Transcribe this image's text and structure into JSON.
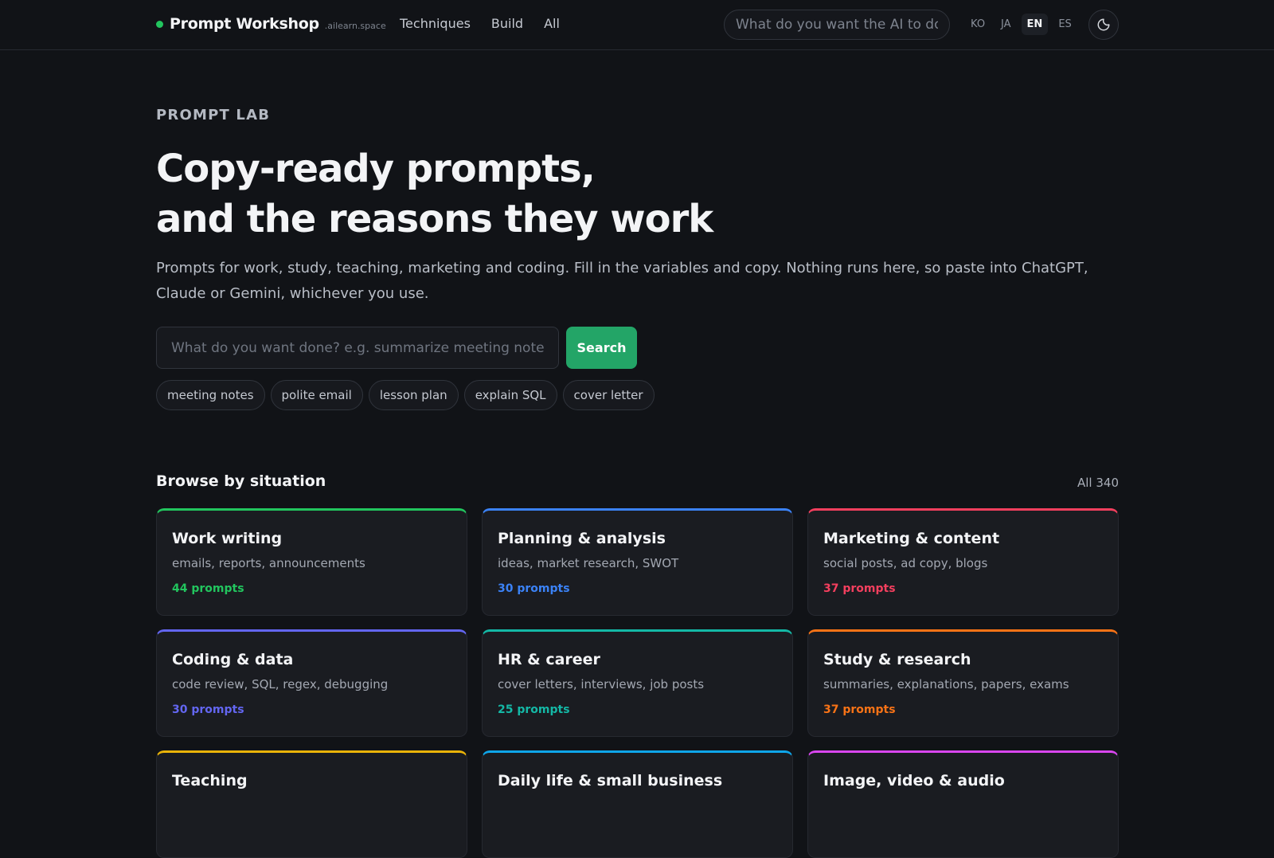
{
  "header": {
    "brand": "Prompt Workshop",
    "domain": ".ailearn.space",
    "nav": [
      "Techniques",
      "Build",
      "All"
    ],
    "search_placeholder": "What do you want the AI to do?",
    "languages": [
      {
        "code": "KO",
        "active": false
      },
      {
        "code": "JA",
        "active": false
      },
      {
        "code": "EN",
        "active": true
      },
      {
        "code": "ES",
        "active": false
      }
    ],
    "theme_icon": "moon-icon"
  },
  "hero": {
    "eyebrow": "PROMPT LAB",
    "headline_line1": "Copy-ready prompts,",
    "headline_line2": "and the reasons they work",
    "lead": "Prompts for work, study, teaching, marketing and coding. Fill in the variables and copy. Nothing runs here, so paste into ChatGPT, Claude or Gemini, whichever you use.",
    "search_placeholder": "What do you want done? e.g. summarize meeting notes",
    "search_button": "Search",
    "chips": [
      "meeting notes",
      "polite email",
      "lesson plan",
      "explain SQL",
      "cover letter"
    ]
  },
  "browse": {
    "title": "Browse by situation",
    "all_link": "All 340",
    "categories": [
      {
        "title": "Work writing",
        "desc": "emails, reports, announcements",
        "count": "44 prompts",
        "color": "#22c55e"
      },
      {
        "title": "Planning & analysis",
        "desc": "ideas, market research, SWOT",
        "count": "30 prompts",
        "color": "#3b82f6"
      },
      {
        "title": "Marketing & content",
        "desc": "social posts, ad copy, blogs",
        "count": "37 prompts",
        "color": "#f43f5e"
      },
      {
        "title": "Coding & data",
        "desc": "code review, SQL, regex, debugging",
        "count": "30 prompts",
        "color": "#6366f1"
      },
      {
        "title": "HR & career",
        "desc": "cover letters, interviews, job posts",
        "count": "25 prompts",
        "color": "#14b8a6"
      },
      {
        "title": "Study & research",
        "desc": "summaries, explanations, papers, exams",
        "count": "37 prompts",
        "color": "#f97316"
      },
      {
        "title": "Teaching",
        "desc": "",
        "count": "",
        "color": "#eab308"
      },
      {
        "title": "Daily life & small business",
        "desc": "",
        "count": "",
        "color": "#0ea5e9"
      },
      {
        "title": "Image, video & audio",
        "desc": "",
        "count": "",
        "color": "#d946ef"
      }
    ]
  }
}
